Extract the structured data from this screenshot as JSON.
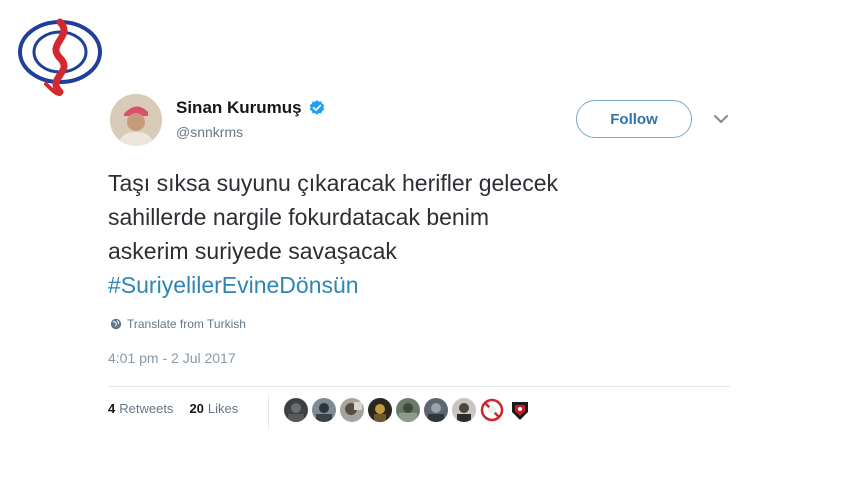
{
  "user": {
    "name": "Sinan Kurumuş",
    "handle": "@snnkrms",
    "verified": true
  },
  "actions": {
    "follow_label": "Follow"
  },
  "tweet": {
    "lines": [
      "Taşı sıksa suyunu çıkaracak herifler gelecek",
      "sahillerde nargile fokurdatacak benim",
      "askerim suriyede savaşacak"
    ],
    "hashtag": "#SuriyelilerEvineDönsün",
    "translate_label": "Translate from Turkish",
    "timestamp": "4:01 pm - 2 Jul 2017"
  },
  "stats": {
    "retweets_count": "4",
    "retweets_label": "Retweets",
    "likes_count": "20",
    "likes_label": "Likes"
  },
  "colors": {
    "hashtag": "#2e86b8",
    "follow_border": "#7aa9cc",
    "verified": "#1da1f2",
    "logo_blue": "#1f3f9a",
    "logo_red": "#d3282f"
  },
  "icons": [
    "channel-logo-icon",
    "verified-badge-icon",
    "chevron-down-icon",
    "globe-icon"
  ]
}
